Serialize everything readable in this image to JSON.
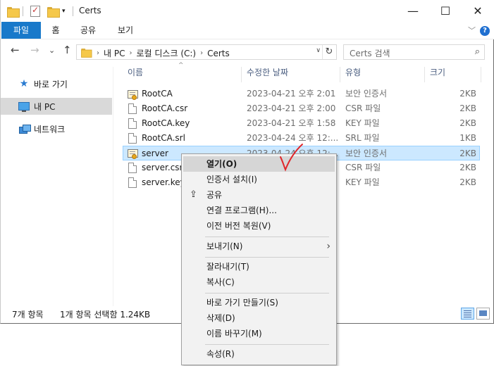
{
  "window": {
    "title": "Certs",
    "controls": {
      "minimize": "—",
      "maximize": "☐",
      "close": "✕"
    }
  },
  "ribbon": {
    "tabs": [
      "파일",
      "홈",
      "공유",
      "보기"
    ],
    "help": "?",
    "collapse": "﹀"
  },
  "navigation": {
    "back": "←",
    "forward": "→",
    "recent": "⌄",
    "up": "↑"
  },
  "address": {
    "crumbs": [
      "내 PC",
      "로컬 디스크 (C:)",
      "Certs"
    ],
    "separator": "›",
    "dropdown": "∨",
    "refresh": "↻"
  },
  "search": {
    "placeholder": "Certs 검색",
    "icon": "⌕"
  },
  "sidebar": {
    "items": [
      {
        "label": "바로 가기",
        "icon": "star-icon"
      },
      {
        "label": "내 PC",
        "icon": "computer-icon"
      },
      {
        "label": "네트워크",
        "icon": "network-icon"
      }
    ]
  },
  "columns": {
    "name": "이름",
    "date": "수정한 날짜",
    "type": "유형",
    "size": "크기",
    "sort_indicator": "^"
  },
  "files": [
    {
      "name": "RootCA",
      "date": "2023-04-21 오후 2:01",
      "type": "보안 인증서",
      "size": "2KB",
      "icon": "certificate-icon"
    },
    {
      "name": "RootCA.csr",
      "date": "2023-04-21 오후 2:00",
      "type": "CSR 파일",
      "size": "2KB",
      "icon": "file-icon"
    },
    {
      "name": "RootCA.key",
      "date": "2023-04-21 오후 1:58",
      "type": "KEY 파일",
      "size": "2KB",
      "icon": "file-icon"
    },
    {
      "name": "RootCA.srl",
      "date": "2023-04-24 오후 12:...",
      "type": "SRL 파일",
      "size": "1KB",
      "icon": "file-icon"
    },
    {
      "name": "server",
      "date": "2023-04-24 오후 12:...",
      "type": "보안 인증서",
      "size": "2KB",
      "icon": "certificate-icon",
      "selected": true
    },
    {
      "name": "server.csr",
      "date": "",
      "type": "CSR 파일",
      "size": "2KB",
      "icon": "file-icon"
    },
    {
      "name": "server.key",
      "date": "",
      "type": "KEY 파일",
      "size": "2KB",
      "icon": "file-icon"
    }
  ],
  "status": {
    "count": "7개 항목",
    "selection": "1개 항목 선택함 1.24KB"
  },
  "context_menu": {
    "open": "열기(O)",
    "install_cert": "인증서 설치(I)",
    "share": "공유",
    "open_with": "연결 프로그램(H)...",
    "restore": "이전 버전 복원(V)",
    "send_to": "보내기(N)",
    "cut": "잘라내기(T)",
    "copy": "복사(C)",
    "create_shortcut": "바로 가기 만들기(S)",
    "delete": "삭제(D)",
    "rename": "이름 바꾸기(M)",
    "properties": "속성(R)",
    "submenu_arrow": "›"
  },
  "annotation": {
    "color": "#e0262a"
  }
}
